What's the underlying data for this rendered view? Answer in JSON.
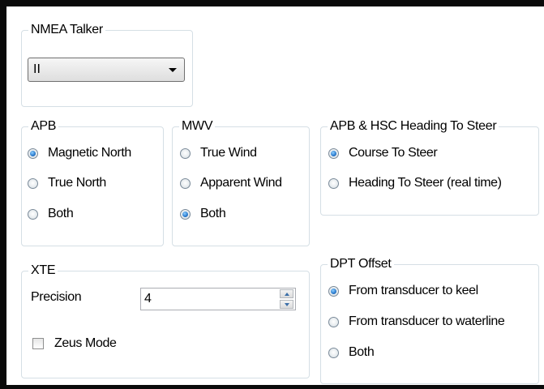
{
  "nmea_talker": {
    "title": "NMEA Talker",
    "selected": "II"
  },
  "apb": {
    "title": "APB",
    "options": [
      {
        "label": "Magnetic North",
        "checked": true
      },
      {
        "label": "True North",
        "checked": false
      },
      {
        "label": "Both",
        "checked": false
      }
    ]
  },
  "mwv": {
    "title": "MWV",
    "options": [
      {
        "label": "True Wind",
        "checked": false
      },
      {
        "label": "Apparent Wind",
        "checked": false
      },
      {
        "label": "Both",
        "checked": true
      }
    ]
  },
  "heading": {
    "title": "APB & HSC Heading To Steer",
    "options": [
      {
        "label": "Course To Steer",
        "checked": true
      },
      {
        "label": "Heading To Steer (real time)",
        "checked": false
      }
    ]
  },
  "xte": {
    "title": "XTE",
    "precision_label": "Precision",
    "precision_value": "4",
    "zeus_label": "Zeus Mode",
    "zeus_checked": false
  },
  "dpt": {
    "title": "DPT Offset",
    "options": [
      {
        "label": "From transducer to keel",
        "checked": true
      },
      {
        "label": "From transducer to waterline",
        "checked": false
      },
      {
        "label": "Both",
        "checked": false
      }
    ]
  }
}
